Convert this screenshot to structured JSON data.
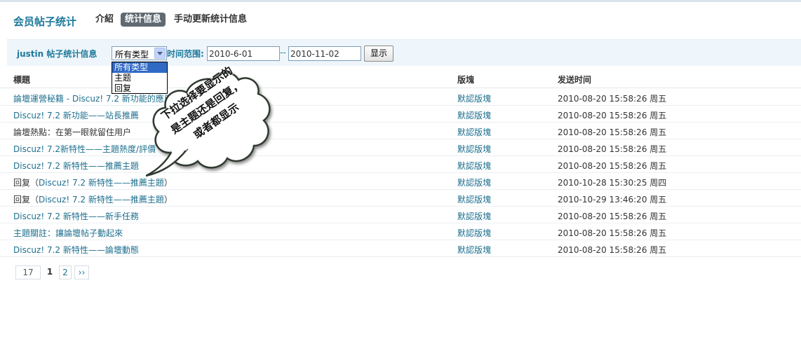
{
  "header": {
    "title": "会员帖子统计",
    "tabs": [
      {
        "label": "介紹",
        "active": false
      },
      {
        "label": "统计信息",
        "active": true
      },
      {
        "label": "手动更新统计信息",
        "active": false
      }
    ]
  },
  "filter": {
    "user_stats_label": "justin 帖子统计信息",
    "type_selected": "所有类型",
    "type_options": [
      "所有类型",
      "主题",
      "回复"
    ],
    "time_range_label": "时间范围:",
    "start_date": "2010-6-01",
    "separator": "--",
    "end_date": "2010-11-02",
    "show_button": "显示"
  },
  "table": {
    "headers": {
      "title": "標題",
      "board": "版塊",
      "time": "发送时间"
    },
    "rows": [
      {
        "title": "論壇運營秘籍 - Discuz! 7.2 新功能的應用",
        "board": "默認版塊",
        "time": "2010-08-20 15:58:26 周五"
      },
      {
        "title": "Discuz! 7.2 新功能——站長推薦",
        "board": "默認版塊",
        "time": "2010-08-20 15:58:26 周五"
      },
      {
        "title": "論壇熱點：在第一眼就留住用户",
        "board": "默認版塊",
        "time": "2010-08-20 15:58:26 周五"
      },
      {
        "title": "Discuz! 7.2新特性——主題熱度/評價",
        "board": "默認版塊",
        "time": "2010-08-20 15:58:26 周五"
      },
      {
        "title": "Discuz! 7.2 新特性——推薦主題",
        "board": "默認版塊",
        "time": "2010-08-20 15:58:26 周五"
      },
      {
        "reply_prefix": "回复（",
        "title": "Discuz! 7.2 新特性——推薦主題",
        "reply_suffix": "）",
        "board": "默認版塊",
        "time": "2010-10-28 15:30:25 周四"
      },
      {
        "reply_prefix": "回复（",
        "title": "Discuz! 7.2 新特性——推薦主題",
        "reply_suffix": "）",
        "board": "默認版塊",
        "time": "2010-10-29 13:46:20 周五"
      },
      {
        "title": "Discuz! 7.2 新特性——新手任務",
        "board": "默認版塊",
        "time": "2010-08-20 15:58:26 周五"
      },
      {
        "title": "主題關註：讓論壇帖子動起來",
        "board": "默認版塊",
        "time": "2010-08-20 15:58:26 周五"
      },
      {
        "title": "Discuz! 7.2 新特性——論壇動態",
        "board": "默認版塊",
        "time": "2010-08-20 15:58:26 周五"
      }
    ]
  },
  "pagination": {
    "total": "17",
    "current": "1",
    "next_page": "2",
    "next_arrow": "››"
  },
  "callout": {
    "lines": [
      "下拉选择要显示的",
      "是主题还是回复，",
      "或者都显示"
    ]
  },
  "colors": {
    "accent": "#1d7a9a",
    "link": "#1d6f8e",
    "filter_bg": "#eef5fb",
    "active_tab_bg": "#5f6a72",
    "selected_option_bg": "#316ac5",
    "callout_fill": "#ffffff",
    "callout_stroke": "#2f3a2f"
  }
}
